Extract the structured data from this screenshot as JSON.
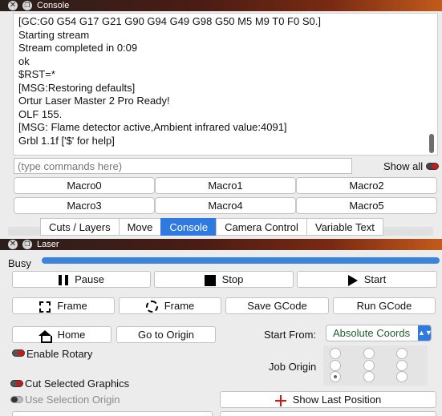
{
  "console": {
    "title": "Console",
    "lines": [
      "[GC:G0 G54 G17 G21 G90 G94 G49 G98 G50 M5 M9 T0 F0 S0.]",
      "Starting stream",
      "Stream completed in 0:09",
      "ok",
      "$RST=*",
      "[MSG:Restoring defaults]",
      "Ortur Laser Master 2 Pro Ready!",
      "OLF 155.",
      "[MSG: Flame detector active,Ambient infrared value:4091]",
      "Grbl 1.1f ['$' for help]"
    ],
    "input_placeholder": "(type commands here)",
    "input_value": "",
    "show_all_label": "Show all",
    "show_all_enabled": true,
    "macros": [
      "Macro0",
      "Macro1",
      "Macro2",
      "Macro3",
      "Macro4",
      "Macro5"
    ]
  },
  "tabs": [
    {
      "label": "Cuts / Layers",
      "active": false
    },
    {
      "label": "Move",
      "active": false
    },
    {
      "label": "Console",
      "active": true
    },
    {
      "label": "Camera Control",
      "active": false
    },
    {
      "label": "Variable Text",
      "active": false
    }
  ],
  "laser": {
    "title": "Laser",
    "status": "Busy",
    "pause_label": "Pause",
    "stop_label": "Stop",
    "start_label": "Start",
    "frame_rect_label": "Frame",
    "frame_circle_label": "Frame",
    "save_gcode_label": "Save GCode",
    "run_gcode_label": "Run GCode",
    "home_label": "Home",
    "go_to_origin_label": "Go to Origin",
    "start_from_label": "Start From:",
    "start_from_value": "Absolute Coords",
    "enable_rotary_label": "Enable Rotary",
    "enable_rotary_on": true,
    "job_origin_label": "Job Origin",
    "job_origin_selected": 6,
    "cut_selected_label": "Cut Selected Graphics",
    "cut_selected_on": true,
    "use_selection_origin_label": "Use Selection Origin",
    "use_selection_origin_on": false,
    "show_last_position_label": "Show Last Position"
  },
  "icons": {
    "pause": "pause-icon",
    "stop": "stop-icon",
    "start": "play-icon",
    "frame_rect": "frame-rectangle-icon",
    "frame_circle": "frame-circle-icon",
    "home": "home-icon",
    "show_last_position": "crosshair-icon"
  },
  "colors": {
    "accent": "#2f7ae0",
    "toggle_on": "#c51b1b",
    "title_gradient_end": "#c25a1c"
  }
}
